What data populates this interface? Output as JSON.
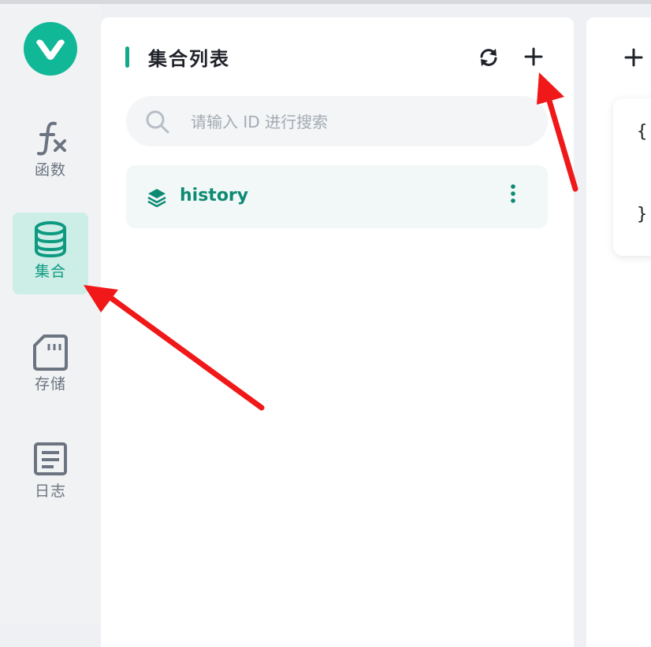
{
  "sidebar": {
    "items": [
      {
        "id": "functions",
        "label": "函数",
        "icon": "function-icon",
        "active": false
      },
      {
        "id": "collections",
        "label": "集合",
        "icon": "database-icon",
        "active": true
      },
      {
        "id": "storage",
        "label": "存储",
        "icon": "sd-card-icon",
        "active": false
      },
      {
        "id": "logs",
        "label": "日志",
        "icon": "log-document-icon",
        "active": false
      }
    ]
  },
  "collection_panel": {
    "title": "集合列表",
    "search": {
      "placeholder": "请输入 ID 进行搜索",
      "value": ""
    },
    "items": [
      {
        "name": "history",
        "icon": "layers-icon"
      }
    ]
  },
  "editor": {
    "code_open": "{",
    "code_close": "}"
  },
  "colors": {
    "accent": "#12a889",
    "active_bg": "#cdeee7",
    "annotation_arrow": "#f01818"
  }
}
